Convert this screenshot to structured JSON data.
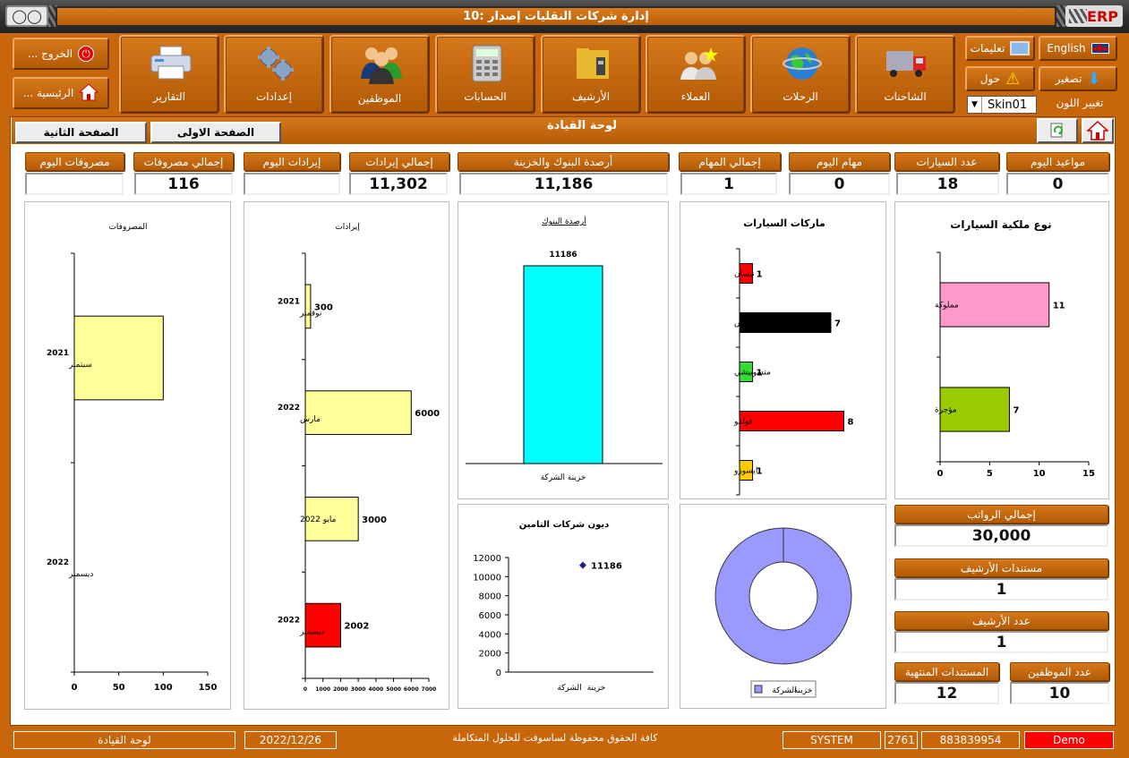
{
  "window": {
    "title": "إدارة شركات النقليات إصدار :10",
    "brand": "ERP"
  },
  "ribbon": {
    "trucks": "الشاحنات",
    "trips": "الرحلات",
    "clients": "العملاء",
    "archive": "الأرشيف",
    "accounts": "الحسابات",
    "employees": "الموظفين",
    "settings": "إعدادات",
    "reports": "التقارير",
    "exit": "الخروج ...",
    "home": "الرئيسية ...",
    "english": "English",
    "instructions": "تعليمات",
    "minimize": "تصغير",
    "about": "حول",
    "change_color": "تغيير اللون",
    "skin": "Skin01"
  },
  "dashboard": {
    "title": "لوحة القيادة",
    "tab_first": "الصفحة الاولى",
    "tab_second": "الصفحة الثانية"
  },
  "stats": {
    "appointments_today": {
      "label": "مواعيد اليوم",
      "value": "0"
    },
    "cars_count": {
      "label": "عدد السيارات",
      "value": "18"
    },
    "tasks_today": {
      "label": "مهام اليوم",
      "value": "0"
    },
    "tasks_total": {
      "label": "إجمالي المهام",
      "value": "1"
    },
    "bank_balances": {
      "label": "أرصدة البنوك والخزينة",
      "value": "11,186"
    },
    "revenue_total": {
      "label": "إجمالي إيرادات",
      "value": "11,302"
    },
    "revenue_today": {
      "label": "إيرادات اليوم",
      "value": ""
    },
    "expenses_total": {
      "label": "إجمالي مصروفات",
      "value": "116"
    },
    "expenses_today": {
      "label": "مصروفات اليوم",
      "value": ""
    },
    "salaries_total": {
      "label": "إجمالي الرواتب",
      "value": "30,000"
    },
    "archive_docs": {
      "label": "مستندات الأرشيف",
      "value": "1"
    },
    "archive_count": {
      "label": "عدد الأرشيف",
      "value": "1"
    },
    "employees_count": {
      "label": "عدد الموظفين",
      "value": "10"
    },
    "expired_docs": {
      "label": "المستندات المنتهية",
      "value": "12"
    }
  },
  "chart_data": [
    {
      "type": "bar",
      "orientation": "horizontal",
      "title": "نوع ملكية السيارات",
      "categories": [
        "مملوكة",
        "مؤجرة"
      ],
      "values": [
        11,
        7
      ],
      "colors": [
        "#ff99cc",
        "#99cc00"
      ],
      "xlim": [
        0,
        15
      ],
      "xticks": [
        "0",
        "5",
        "10",
        "15"
      ]
    },
    {
      "type": "bar",
      "orientation": "horizontal",
      "title": "ماركات السيارات",
      "categories": [
        "نيسان",
        "مرسيدس",
        "متسوبيشي",
        "فولفو",
        "ايسوزو"
      ],
      "values": [
        1,
        7,
        1,
        8,
        1
      ],
      "colors": [
        "#ff0000",
        "#000000",
        "#33dd33",
        "#ff0000",
        "#ffcc00"
      ]
    },
    {
      "type": "bar",
      "title": "أرصدة البنوك",
      "categories": [
        "خزينة الشركة"
      ],
      "values": [
        11186
      ],
      "colors": [
        "#00ffff"
      ]
    },
    {
      "type": "bar",
      "orientation": "horizontal",
      "title": "إيرادات",
      "categories": [
        [
          "2021",
          "نوفمبر"
        ],
        [
          "2022",
          "مارس"
        ],
        [
          "مايو 2022"
        ],
        [
          "2022",
          "ديسمبر"
        ]
      ],
      "values": [
        300,
        6000,
        3000,
        2002
      ],
      "colors": [
        "#ffff99",
        "#ffff99",
        "#ffff99",
        "#ff0000"
      ],
      "xlim": [
        0,
        7000
      ],
      "xticks": [
        "0",
        "1000",
        "2000",
        "3000",
        "4000",
        "5000",
        "6000",
        "7000"
      ]
    },
    {
      "type": "bar",
      "orientation": "horizontal",
      "title": "المصروفات",
      "categories": [
        [
          "2021",
          "سبتمبر"
        ],
        [
          "2022",
          "ديسمبر"
        ]
      ],
      "values": [
        100,
        0
      ],
      "colors": [
        "#ffff99",
        "#ffff99"
      ],
      "xlim": [
        0,
        150
      ],
      "xticks": [
        "0",
        "50",
        "100",
        "150"
      ]
    },
    {
      "type": "scatter",
      "title": "ديون   شركات   التامين",
      "x_label_parts": [
        "خزينة",
        "الشركة"
      ],
      "points": [
        {
          "y": 11186,
          "label": "11186"
        }
      ],
      "ylim": [
        0,
        12000
      ],
      "yticks": [
        "0",
        "2000",
        "4000",
        "6000",
        "8000",
        "10000",
        "12000"
      ]
    },
    {
      "type": "pie",
      "donut": true,
      "labels": [
        "خزينة الشركة"
      ],
      "legend_text": [
        "خزينة",
        "الشركة"
      ],
      "values": [
        100
      ],
      "colors": [
        "#9999ff"
      ]
    }
  ],
  "status": {
    "screen": "لوحة القيادة",
    "date": "2022/12/26",
    "copyright": "كافة الحقوق محفوظة لساسوفت للحلول المتكاملة",
    "user": "SYSTEM",
    "code1": "2761",
    "code2": "883839954",
    "mode": "Demo"
  }
}
